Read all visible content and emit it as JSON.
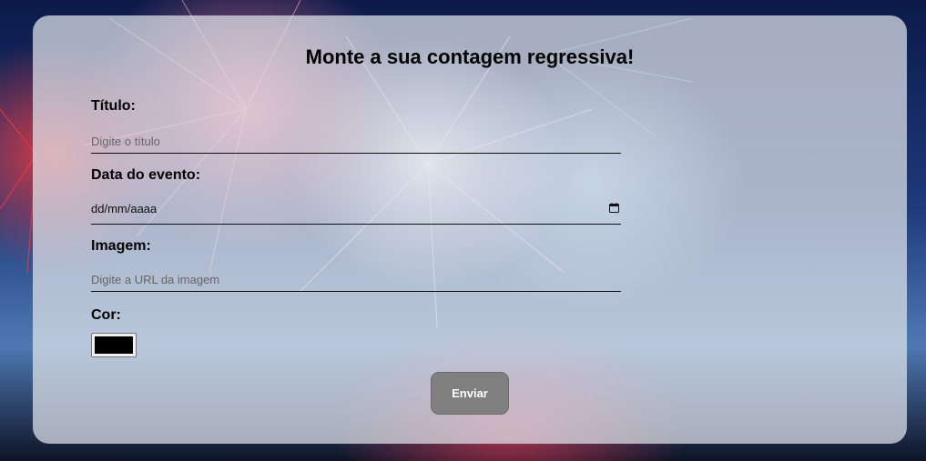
{
  "form": {
    "title": "Monte a sua contagem regressiva!",
    "fields": {
      "titulo": {
        "label": "Título:",
        "placeholder": "Digite o título"
      },
      "data": {
        "label": "Data do evento:",
        "value": "dd/mm/aaaa",
        "icon": "calendar-icon"
      },
      "imagem": {
        "label": "Imagem:",
        "placeholder": "Digite a URL da imagem"
      },
      "cor": {
        "label": "Cor:",
        "value": "#000000"
      }
    },
    "submit_label": "Enviar"
  },
  "colors": {
    "card_background": "#e1e4eb",
    "button_background": "#808080",
    "button_text": "#ffffff"
  }
}
